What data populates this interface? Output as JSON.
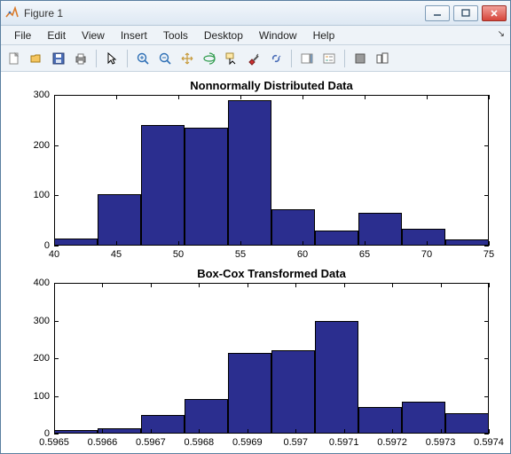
{
  "window": {
    "title": "Figure 1"
  },
  "menu": {
    "file": "File",
    "edit": "Edit",
    "view": "View",
    "insert": "Insert",
    "tools": "Tools",
    "desktop": "Desktop",
    "window": "Window",
    "help": "Help"
  },
  "toolbar_icons": [
    "new-figure-icon",
    "open-icon",
    "save-icon",
    "print-icon",
    "sep",
    "pointer-icon",
    "sep",
    "zoom-in-icon",
    "zoom-out-icon",
    "pan-icon",
    "rotate-3d-icon",
    "data-cursor-icon",
    "brush-icon",
    "link-icon",
    "sep",
    "colorbar-icon",
    "legend-icon",
    "sep",
    "hide-plot-tools-icon",
    "show-plot-tools-icon"
  ],
  "chart_data": [
    {
      "type": "bar",
      "title": "Nonnormally Distributed Data",
      "xlim": [
        40,
        75
      ],
      "ylim": [
        0,
        300
      ],
      "yticks": [
        0,
        100,
        200,
        300
      ],
      "xticks": [
        40,
        45,
        50,
        55,
        60,
        65,
        70,
        75
      ],
      "bin_width": 3.5,
      "bars": [
        {
          "x": 40.0,
          "y": 15
        },
        {
          "x": 43.5,
          "y": 103
        },
        {
          "x": 47.0,
          "y": 240
        },
        {
          "x": 50.5,
          "y": 235
        },
        {
          "x": 54.0,
          "y": 290
        },
        {
          "x": 57.5,
          "y": 73
        },
        {
          "x": 61.0,
          "y": 30
        },
        {
          "x": 64.5,
          "y": 65
        },
        {
          "x": 68.0,
          "y": 33
        },
        {
          "x": 71.5,
          "y": 13
        }
      ]
    },
    {
      "type": "bar",
      "title": "Box-Cox Transformed Data",
      "xlim": [
        0.5965,
        0.5974
      ],
      "ylim": [
        0,
        400
      ],
      "yticks": [
        0,
        100,
        200,
        300,
        400
      ],
      "xticks": [
        0.5965,
        0.5966,
        0.5967,
        0.5968,
        0.5969,
        0.597,
        0.5971,
        0.5972,
        0.5973,
        0.5974
      ],
      "bin_width": 9e-05,
      "bars": [
        {
          "x": 0.5965,
          "y": 10
        },
        {
          "x": 0.59659,
          "y": 15
        },
        {
          "x": 0.59668,
          "y": 50
        },
        {
          "x": 0.59677,
          "y": 92
        },
        {
          "x": 0.59686,
          "y": 215
        },
        {
          "x": 0.59695,
          "y": 222
        },
        {
          "x": 0.59704,
          "y": 300
        },
        {
          "x": 0.59713,
          "y": 70
        },
        {
          "x": 0.59722,
          "y": 85
        },
        {
          "x": 0.59731,
          "y": 53
        }
      ]
    }
  ]
}
